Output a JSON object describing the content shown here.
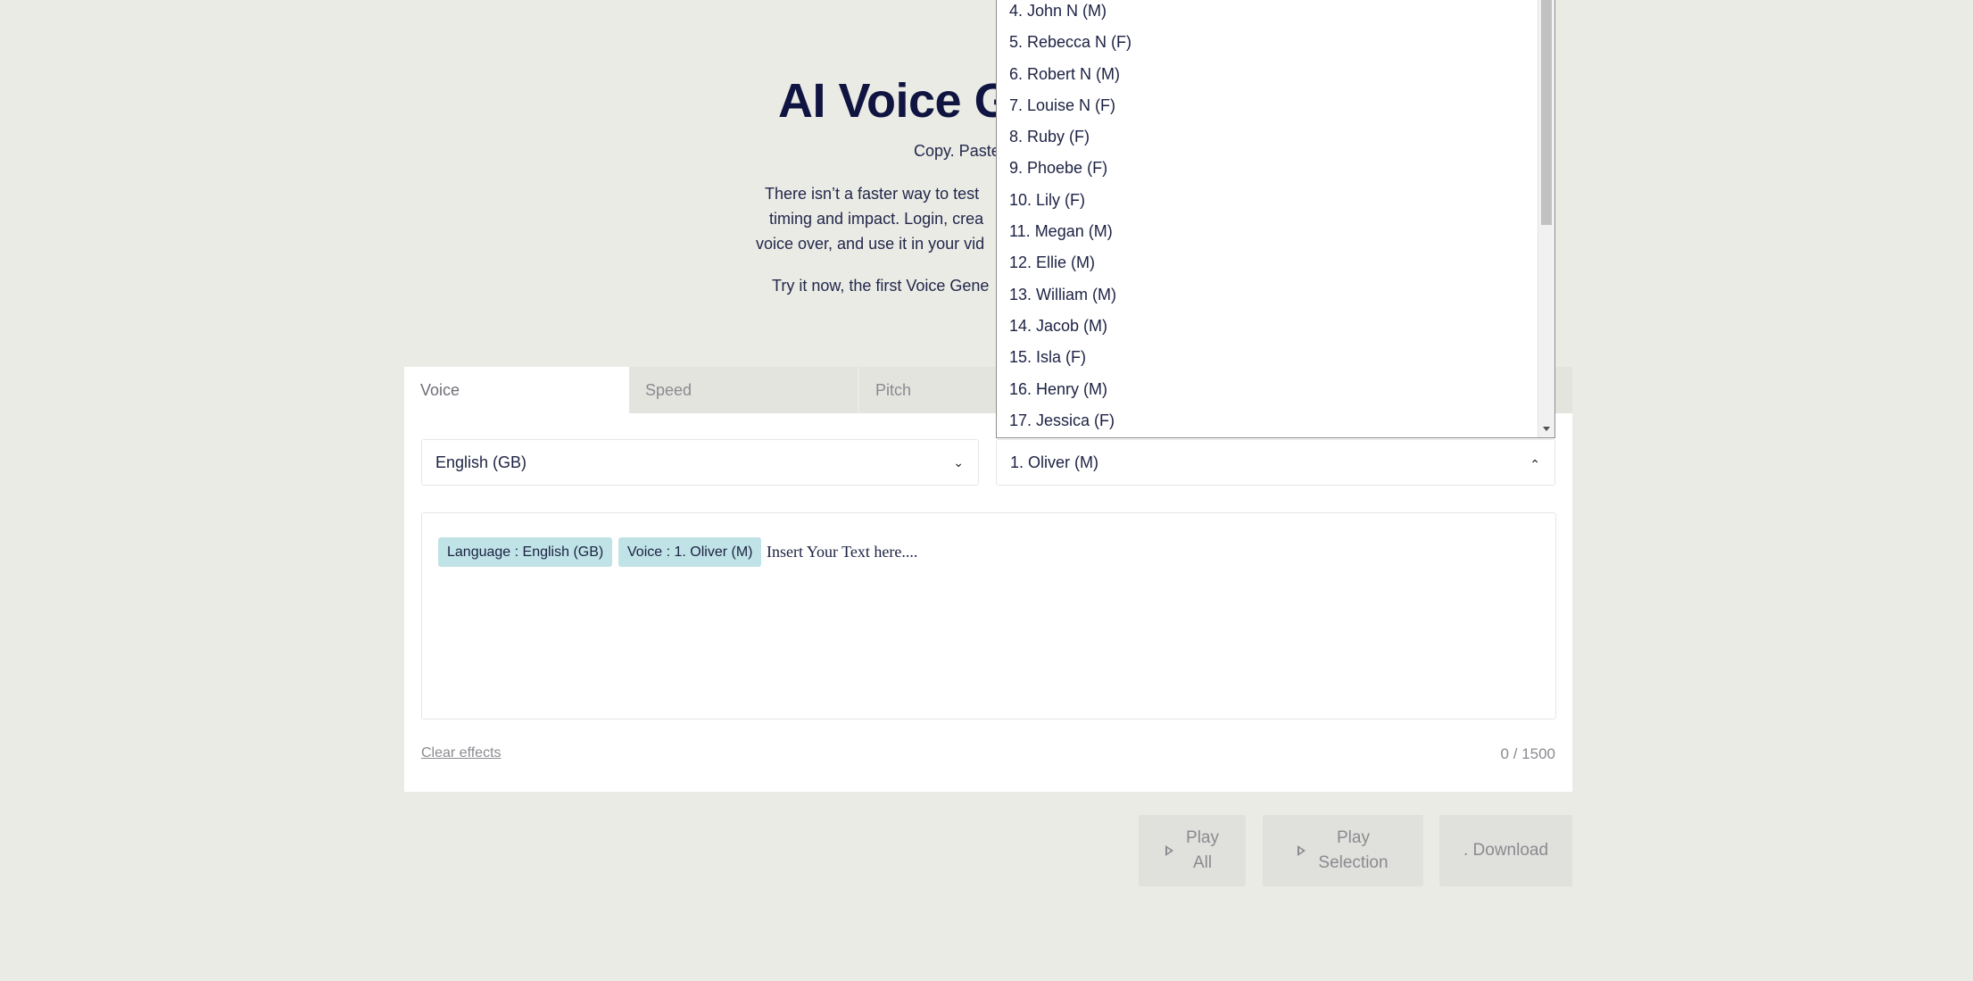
{
  "hero": {
    "title": "AI Voice G",
    "subtitle": "Copy. Paste",
    "para_lines": [
      "There isn’t a faster way to test",
      "timing and impact. Login, crea",
      "voice over, and use it in your vid"
    ],
    "try_line": "Try it now, the first Voice Gene"
  },
  "tabs": [
    {
      "label": "Voice",
      "active": true
    },
    {
      "label": "Speed",
      "active": false
    },
    {
      "label": "Pitch",
      "active": false
    }
  ],
  "language_select": {
    "value": "English (GB)",
    "icon": "chevron-down-icon"
  },
  "voice_select": {
    "value": "1. Oliver (M)",
    "icon": "chevron-up-icon",
    "open": true
  },
  "voice_options": [
    "4. John N (M)",
    "5. Rebecca N (F)",
    "6. Robert N (M)",
    "7. Louise N (F)",
    "8. Ruby (F)",
    "9. Phoebe (F)",
    "10. Lily (F)",
    "11. Megan (M)",
    "12. Ellie (M)",
    "13. William (M)",
    "14. Jacob (M)",
    "15. Isla (F)",
    "16. Henry (M)",
    "17. Jessica (F)"
  ],
  "editor": {
    "tags": [
      "Language : English (GB)",
      "Voice : 1. Oliver (M)"
    ],
    "placeholder": "Insert Your Text here...."
  },
  "footer": {
    "clear_label": "Clear effects",
    "counter": "0 / 1500"
  },
  "buttons": {
    "play_all": [
      "Play",
      "All"
    ],
    "play_selection": [
      "Play",
      "Selection"
    ],
    "download": ". Download"
  },
  "colors": {
    "background": "#ebebe6",
    "title": "#0f1440",
    "tag_bg": "#bfe3e6",
    "button_bg": "#e0e0dc"
  }
}
